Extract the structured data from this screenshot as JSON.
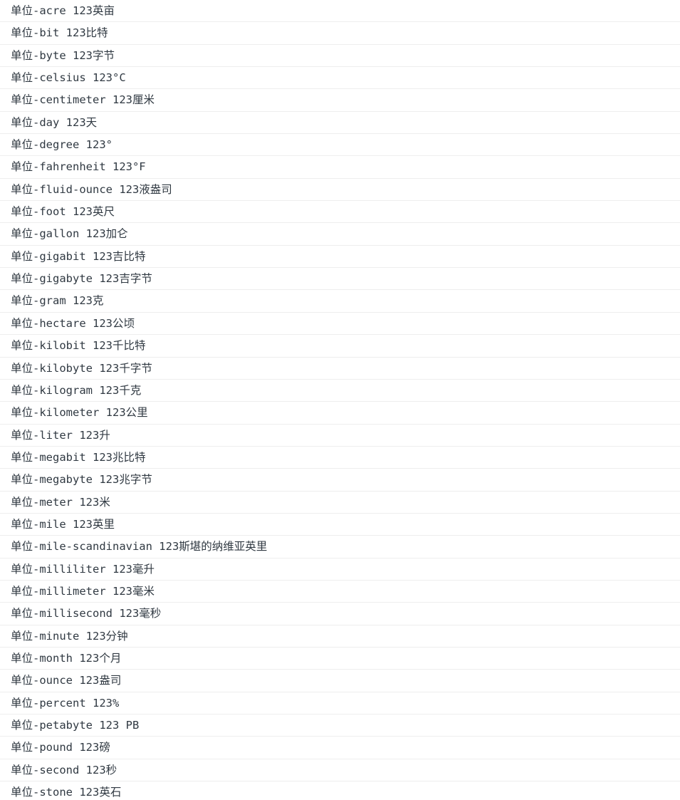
{
  "console": {
    "lines": [
      "单位-acre 123英亩",
      "单位-bit 123比特",
      "单位-byte 123字节",
      "单位-celsius 123°C",
      "单位-centimeter 123厘米",
      "单位-day 123天",
      "单位-degree 123°",
      "单位-fahrenheit 123°F",
      "单位-fluid-ounce 123液盎司",
      "单位-foot 123英尺",
      "单位-gallon 123加仑",
      "单位-gigabit 123吉比特",
      "单位-gigabyte 123吉字节",
      "单位-gram 123克",
      "单位-hectare 123公顷",
      "单位-kilobit 123千比特",
      "单位-kilobyte 123千字节",
      "单位-kilogram 123千克",
      "单位-kilometer 123公里",
      "单位-liter 123升",
      "单位-megabit 123兆比特",
      "单位-megabyte 123兆字节",
      "单位-meter 123米",
      "单位-mile 123英里",
      "单位-mile-scandinavian 123斯堪的纳维亚英里",
      "单位-milliliter 123毫升",
      "单位-millimeter 123毫米",
      "单位-millisecond 123毫秒",
      "单位-minute 123分钟",
      "单位-month 123个月",
      "单位-ounce 123盎司",
      "单位-percent 123%",
      "单位-petabyte 123 PB",
      "单位-pound 123磅",
      "单位-second 123秒",
      "单位-stone 123英石"
    ]
  }
}
